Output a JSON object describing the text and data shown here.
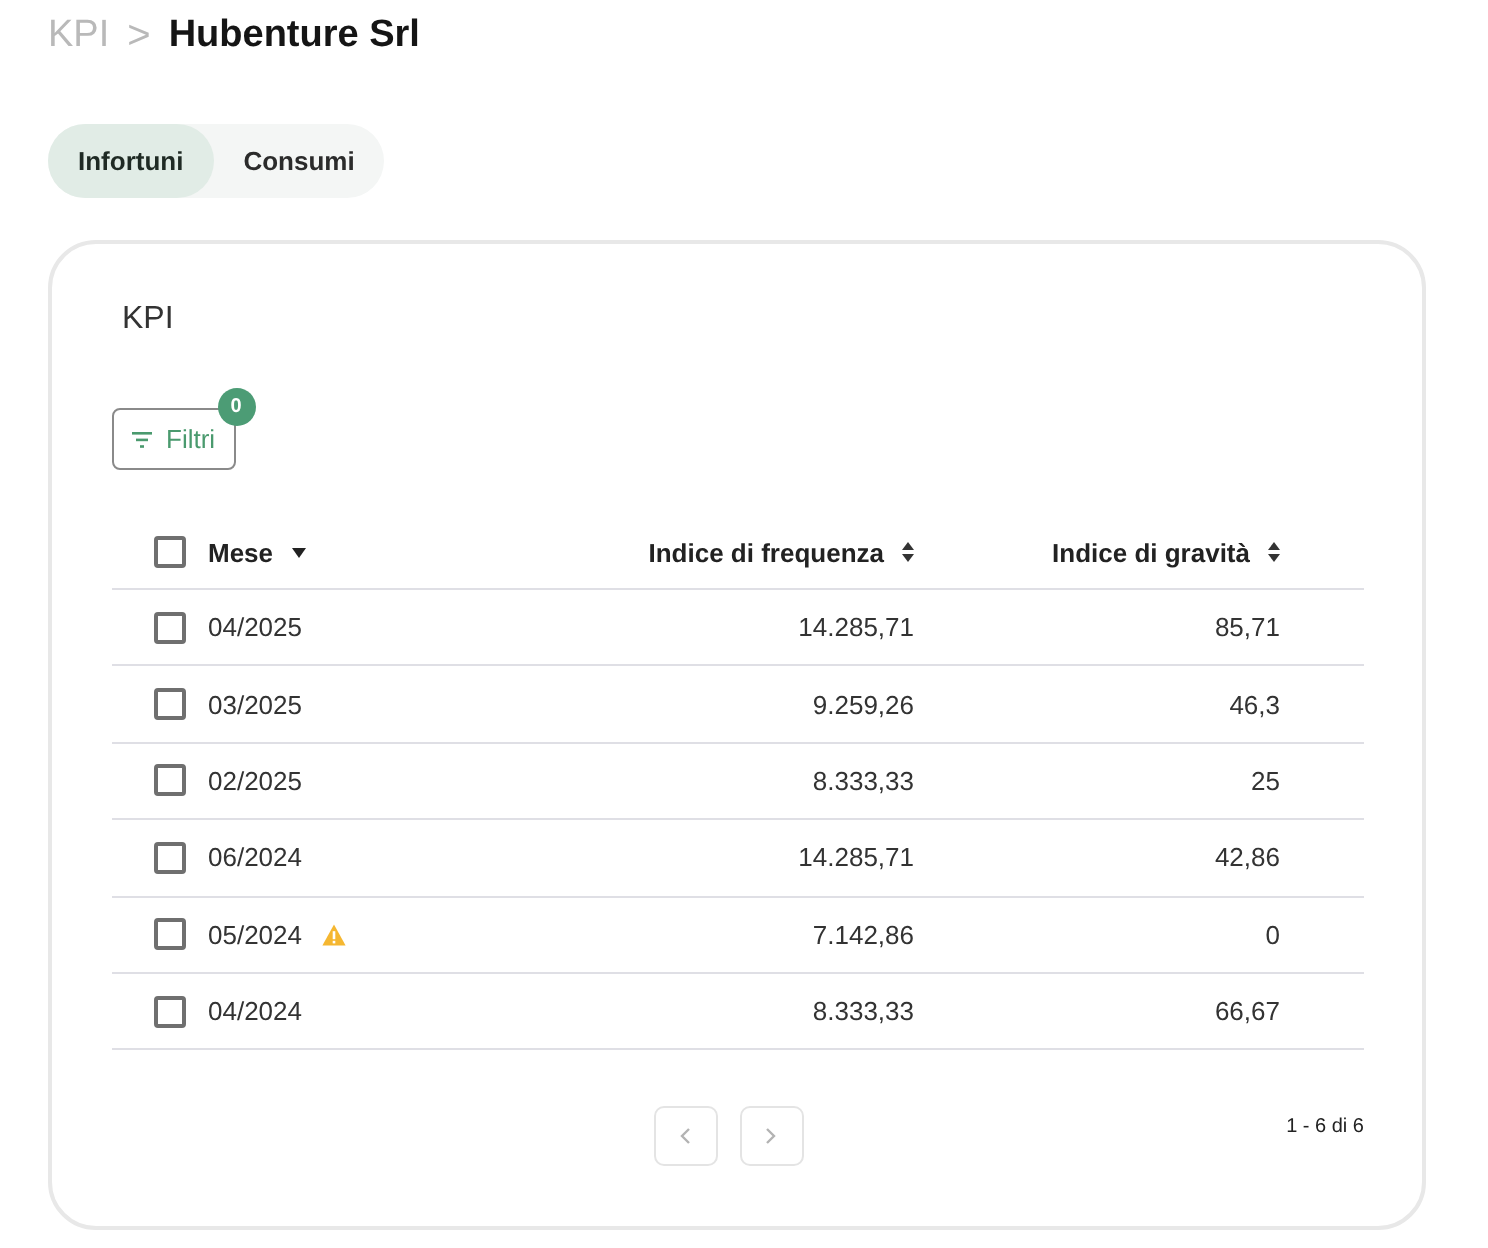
{
  "breadcrumb": {
    "items": [
      {
        "label": "KPI",
        "current": false
      },
      {
        "label": "Hubenture Srl",
        "current": true
      }
    ],
    "separator": ">"
  },
  "tabs": [
    {
      "label": "Infortuni",
      "selected": true
    },
    {
      "label": "Consumi",
      "selected": false
    }
  ],
  "card": {
    "title": "KPI",
    "filter_button": {
      "label": "Filtri",
      "badge": "0"
    },
    "table": {
      "select_all": {
        "checked": false
      },
      "columns": [
        {
          "label": "Mese",
          "sorted": true
        },
        {
          "label": "Indice di frequenza",
          "sorted": false
        },
        {
          "label": "Indice di gravità",
          "sorted": false
        }
      ],
      "rows": [
        {
          "checked": false,
          "warning": false,
          "cells": [
            "04/2025",
            "14.285,71",
            "85,71"
          ]
        },
        {
          "checked": false,
          "warning": false,
          "cells": [
            "03/2025",
            "9.259,26",
            "46,3"
          ]
        },
        {
          "checked": false,
          "warning": false,
          "cells": [
            "02/2025",
            "8.333,33",
            "25"
          ]
        },
        {
          "checked": false,
          "warning": false,
          "cells": [
            "06/2024",
            "14.285,71",
            "42,86"
          ]
        },
        {
          "checked": false,
          "warning": true,
          "cells": [
            "05/2024",
            "7.142,86",
            "0"
          ]
        },
        {
          "checked": false,
          "warning": false,
          "cells": [
            "04/2024",
            "8.333,33",
            "66,67"
          ]
        }
      ]
    },
    "pagination": {
      "previous": {
        "disabled": true
      },
      "next": {
        "disabled": true
      },
      "range": "1 - 6 di 6"
    }
  }
}
